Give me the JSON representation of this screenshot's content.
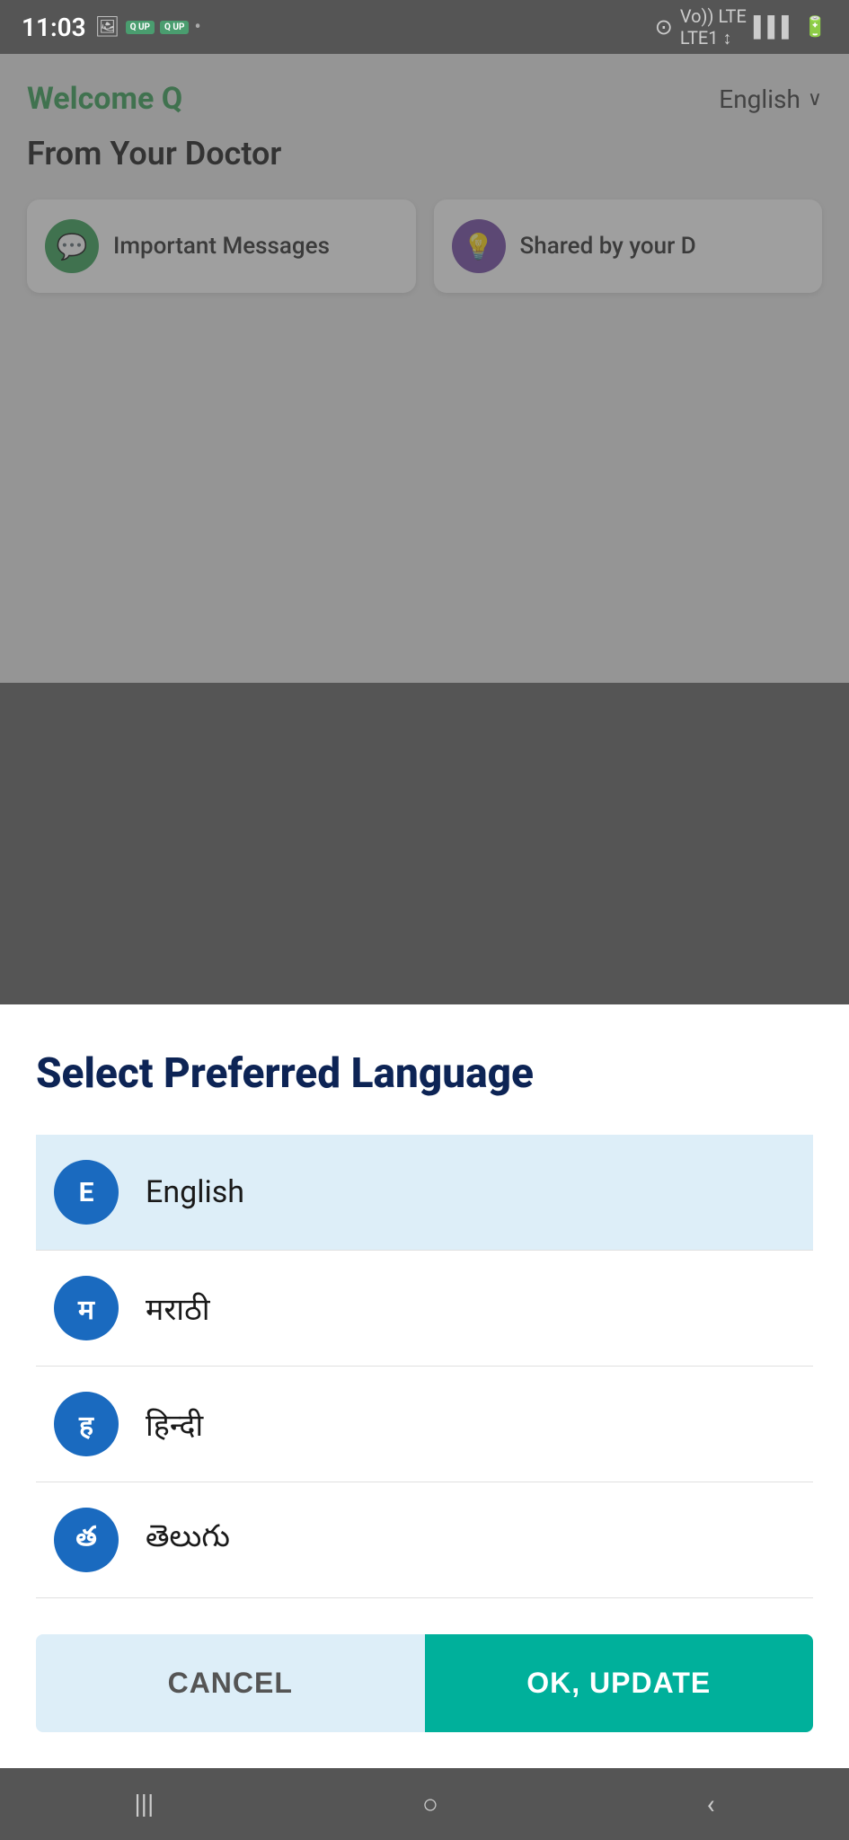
{
  "statusBar": {
    "time": "11:03",
    "dotColor": "#888"
  },
  "appBg": {
    "welcomeText": "Welcome Q",
    "languageLabel": "English",
    "fromDoctorTitle": "From Your Doctor",
    "cards": [
      {
        "id": "important-messages",
        "label": "Important Messages",
        "iconType": "green",
        "icon": "💬"
      },
      {
        "id": "shared-by-doctor",
        "label": "Shared by your D",
        "iconType": "purple",
        "icon": "💡"
      }
    ]
  },
  "bottomSheet": {
    "title": "Select Preferred Language",
    "languages": [
      {
        "id": "english",
        "avatar": "E",
        "name": "English",
        "selected": true
      },
      {
        "id": "marathi",
        "avatar": "म",
        "name": "मराठी",
        "selected": false
      },
      {
        "id": "hindi",
        "avatar": "ह",
        "name": "हिन्दी",
        "selected": false
      },
      {
        "id": "telugu",
        "avatar": "త",
        "name": "తెలుగు",
        "selected": false
      }
    ],
    "cancelLabel": "CANCEL",
    "okLabel": "OK, UPDATE"
  },
  "bottomNav": {
    "icons": [
      "|||",
      "○",
      "<"
    ]
  }
}
